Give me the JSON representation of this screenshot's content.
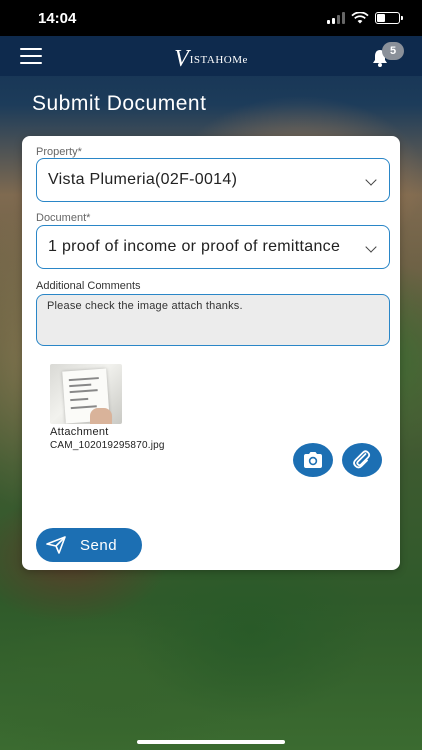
{
  "status_bar": {
    "time": "14:04"
  },
  "navbar": {
    "logo_v": "V",
    "logo_text": "ISTAHOMe",
    "notification_count": "5"
  },
  "page": {
    "title": "Submit Document"
  },
  "form": {
    "property_label": "Property*",
    "property_value": "Vista Plumeria(02F-0014)",
    "document_label": "Document*",
    "document_value": "1 proof of income or proof of remittance",
    "comments_label": "Additional Comments",
    "comments_value": "Please check the image attach thanks."
  },
  "attachment": {
    "label": "Attachment",
    "filename": "CAM_102019295870.jpg"
  },
  "actions": {
    "camera_icon": "camera-icon",
    "paperclip_icon": "paperclip-icon",
    "send_label": "Send"
  },
  "colors": {
    "navbar": "#0e2a4d",
    "accent": "#1c6fb3",
    "field_border": "#2a86c7"
  }
}
